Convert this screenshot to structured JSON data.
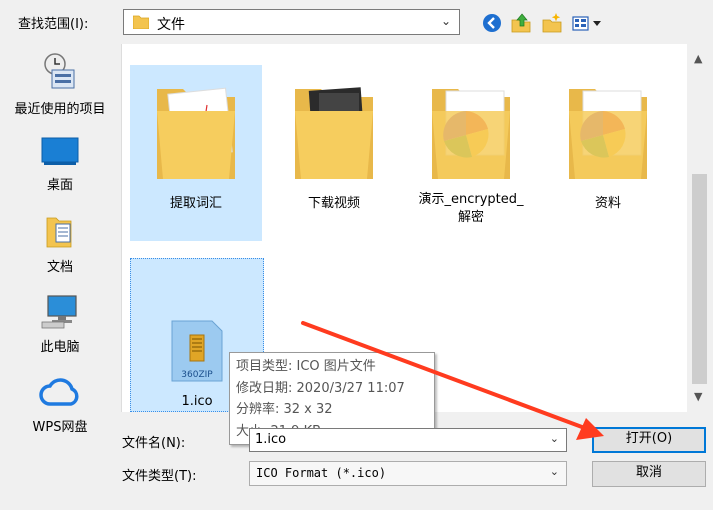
{
  "dialog": {
    "lookin_label": "查找范围(I):",
    "lookin_value": "文件",
    "accent": "#0078d7",
    "annotation_color": "#ff3b1f"
  },
  "toolbar": {
    "icons": [
      "back-icon",
      "up-folder-icon",
      "new-folder-icon",
      "view-menu-icon"
    ]
  },
  "sidebar": {
    "items": [
      {
        "label": "最近使用的项目",
        "icon": "recent-items-icon"
      },
      {
        "label": "桌面",
        "icon": "desktop-icon"
      },
      {
        "label": "文档",
        "icon": "documents-icon"
      },
      {
        "label": "此电脑",
        "icon": "this-pc-icon"
      },
      {
        "label": "WPS网盘",
        "icon": "cloud-icon"
      }
    ]
  },
  "files": [
    {
      "name": "提取词汇",
      "icon": "folder-icon",
      "selected": true
    },
    {
      "name": "下载视频",
      "icon": "folder-icon",
      "selected": false
    },
    {
      "name_line1": "演示_encrypted_",
      "name_line2": "解密",
      "icon": "folder-icon",
      "selected": false
    },
    {
      "name": "资料",
      "icon": "folder-icon",
      "selected": false
    },
    {
      "name": "1.ico",
      "icon": "360zip-icon",
      "icon_text": "360ZIP",
      "selected": true
    }
  ],
  "tooltip": {
    "line1": "项目类型: ICO 图片文件",
    "line2": "修改日期: 2020/3/27 11:07",
    "line3": "分辨率: 32 x 32",
    "line4": "大小: 21.9 KB"
  },
  "filename": {
    "label": "文件名(N):",
    "value": "1.ico"
  },
  "filetype": {
    "label": "文件类型(T):",
    "value": "ICO Format (*.ico)"
  },
  "buttons": {
    "open": "打开(O)",
    "cancel": "取消"
  }
}
